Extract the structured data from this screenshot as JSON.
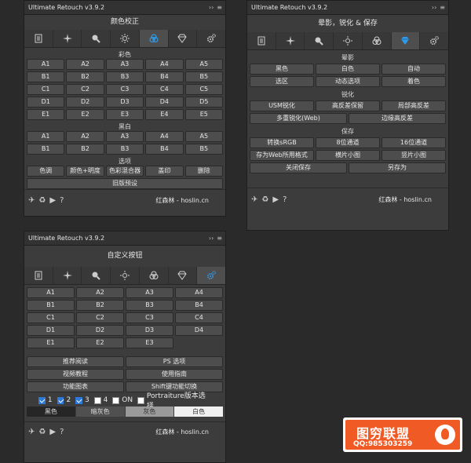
{
  "panel1": {
    "title": "Ultimate Retouch v3.9.2",
    "heading": "颜色校正",
    "section_color": "彩色",
    "color_rows": [
      [
        "A1",
        "A2",
        "A3",
        "A4",
        "A5"
      ],
      [
        "B1",
        "B2",
        "B3",
        "B4",
        "B5"
      ],
      [
        "C1",
        "C2",
        "C3",
        "C4",
        "C5"
      ],
      [
        "D1",
        "D2",
        "D3",
        "D4",
        "D5"
      ],
      [
        "E1",
        "E2",
        "E3",
        "E4",
        "E5"
      ]
    ],
    "section_bw": "黑白",
    "bw_rows": [
      [
        "A1",
        "A2",
        "A3",
        "A4",
        "A5"
      ],
      [
        "B1",
        "B2",
        "B3",
        "B4",
        "B5"
      ]
    ],
    "section_options": "选项",
    "options": [
      "色调",
      "颜色+明度",
      "色彩混合器",
      "盖印",
      "删除"
    ],
    "legacy": "旧版预设",
    "credit": "红森林 - hoslin.cn"
  },
  "panel2": {
    "title": "Ultimate Retouch v3.9.2",
    "heading": "晕影，锐化 & 保存",
    "section_vignette": "晕影",
    "vignette_row1": [
      "黑色",
      "白色",
      "自动"
    ],
    "vignette_row2": [
      "选区",
      "动态选项",
      "着色"
    ],
    "section_sharpen": "锐化",
    "sharpen_row1": [
      "USM锐化",
      "高反差保留",
      "局部高反差"
    ],
    "sharpen_row2": [
      "多重锐化(Web)",
      "边缘高反差"
    ],
    "section_save": "保存",
    "save_row1": [
      "转换sRGB",
      "8位通道",
      "16位通道"
    ],
    "save_row2": [
      "存为Web所用格式",
      "横片小图",
      "竖片小图"
    ],
    "save_row3": [
      "关闭保存",
      "另存为"
    ],
    "credit": "红森林 - hoslin.cn"
  },
  "panel3": {
    "title": "Ultimate Retouch v3.9.2",
    "heading": "自定义按钮",
    "custom_rows": [
      [
        "A1",
        "A2",
        "A3",
        "A4"
      ],
      [
        "B1",
        "B2",
        "B3",
        "B4"
      ],
      [
        "C1",
        "C2",
        "C3",
        "C4"
      ],
      [
        "D1",
        "D2",
        "D3",
        "D4"
      ],
      [
        "E1",
        "E2",
        "E3"
      ]
    ],
    "links": [
      [
        "推荐阅读",
        "PS 选项"
      ],
      [
        "视频教程",
        "使用指南"
      ],
      [
        "功能图表",
        "Shift键功能切换"
      ]
    ],
    "check1": "1",
    "check2": "2",
    "check3": "3",
    "check4": "4",
    "check_on": "ON",
    "portraiture": "Portraiture版本选择",
    "themes": [
      "黑色",
      "暗灰色",
      "灰色",
      "白色"
    ],
    "credit": "红森林 - hoslin.cn"
  },
  "watermark": {
    "name": "图穷联盟",
    "qq": "QQ:985303259"
  },
  "colors": {
    "panel_bg": "#3c3c3c",
    "button_bg": "#4d4d4d",
    "active_icon_blue": "#2f9be8",
    "watermark_orange": "#f05a24"
  }
}
